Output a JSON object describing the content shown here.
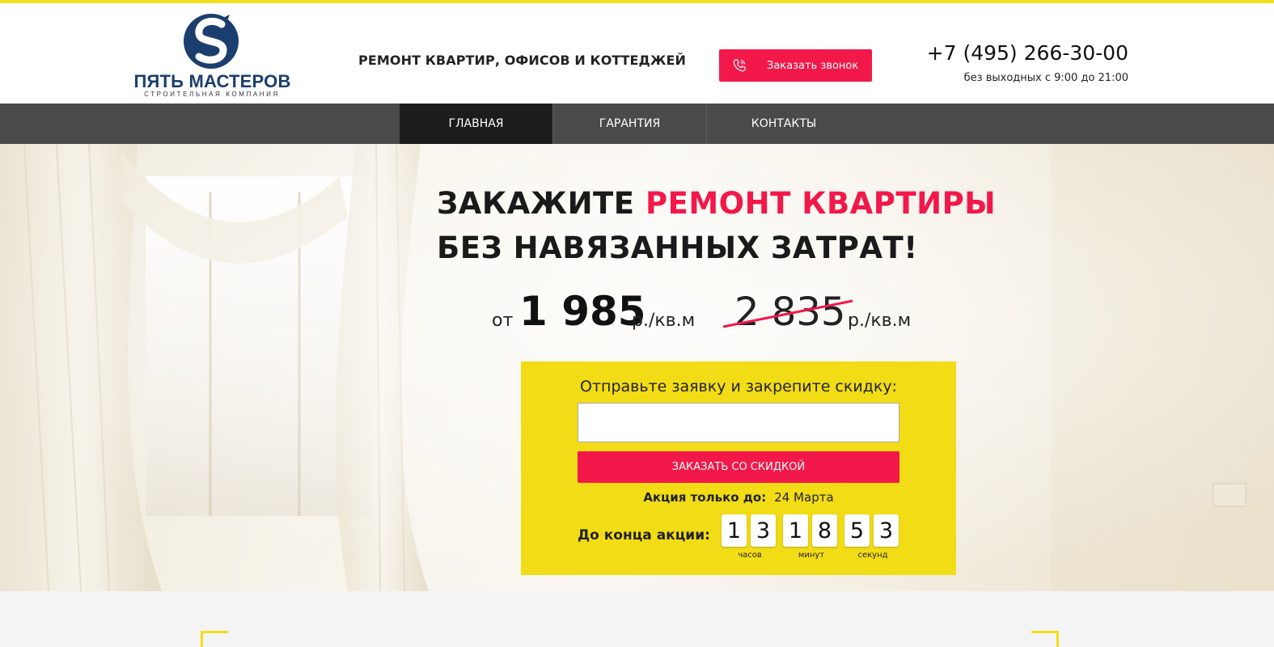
{
  "brand": {
    "name": "ПЯТЬ МАСТЕРОВ",
    "subtitle": "СТРОИТЕЛЬНАЯ КОМПАНИЯ",
    "colors": {
      "navy": "#1b3e6e",
      "accent_red": "#f2184a",
      "accent_yellow": "#f2dc16",
      "nav_bg": "#4a4a4a",
      "nav_active": "#1c1c1c"
    }
  },
  "header": {
    "tagline": "РЕМОНТ КВАРТИР, ОФИСОВ И КОТТЕДЖЕЙ",
    "callback_label": "Заказать звонок",
    "callback_icon": "phone-ringing-icon",
    "phone": "+7 (495) 266-30-00",
    "hours": "без выходных с 9:00 до 21:00"
  },
  "nav": {
    "items": [
      {
        "label": "ГЛАВНАЯ",
        "active": true
      },
      {
        "label": "ГАРАНТИЯ",
        "active": false
      },
      {
        "label": "КОНТАКТЫ",
        "active": false
      }
    ]
  },
  "hero": {
    "line1_prefix": "ЗАКАЖИТЕ",
    "line1_accent": "РЕМОНТ КВАРТИРЫ",
    "line2": "БЕЗ НАВЯЗАННЫХ ЗАТРАТ!",
    "price": {
      "from": "от",
      "new_value": "1 985",
      "unit": "р./кв.м",
      "old_value": "2 835",
      "old_unit": "р./кв.м"
    }
  },
  "form": {
    "title": "Отправьте заявку и закрепите скидку:",
    "input_value": "",
    "input_placeholder": "",
    "submit_label": "ЗАКАЗАТЬ СО СКИДКОЙ",
    "promo_label": "Акция только до:",
    "promo_date": "24 Марта",
    "countdown_label": "До конца акции:",
    "countdown": {
      "hours": [
        "1",
        "3"
      ],
      "minutes": [
        "1",
        "8"
      ],
      "seconds": [
        "5",
        "3"
      ],
      "hours_label": "часов",
      "minutes_label": "минут",
      "seconds_label": "секунд"
    }
  }
}
